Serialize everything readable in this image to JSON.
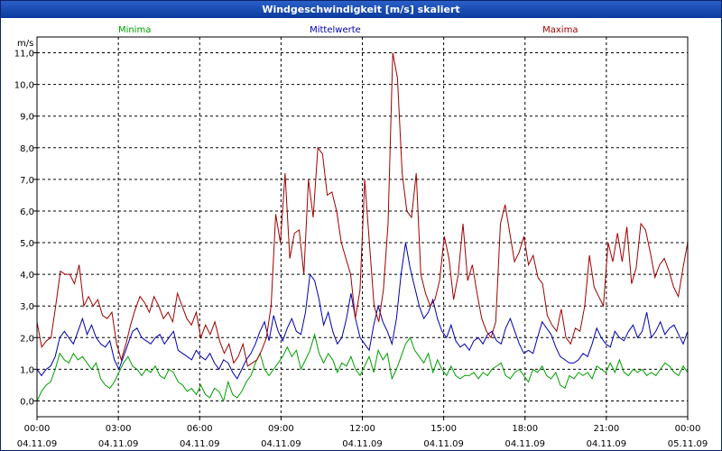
{
  "window": {
    "title": "Windgeschwindigkeit [m/s] skaliert"
  },
  "chart_data": {
    "type": "line",
    "title": "Windgeschwindigkeit [m/s] skaliert",
    "ylabel": "m/s",
    "ylim": [
      -0.5,
      11.5
    ],
    "xlim": [
      0,
      24
    ],
    "y_ticks": [
      "0,0",
      "1,0",
      "2,0",
      "3,0",
      "4,0",
      "5,0",
      "6,0",
      "7,0",
      "8,0",
      "9,0",
      "10,0",
      "11,0"
    ],
    "x_ticks": [
      {
        "time": "00:00",
        "date": "04.11.09"
      },
      {
        "time": "03:00",
        "date": "04.11.09"
      },
      {
        "time": "06:00",
        "date": "04.11.09"
      },
      {
        "time": "09:00",
        "date": "04.11.09"
      },
      {
        "time": "12:00",
        "date": "04.11.09"
      },
      {
        "time": "15:00",
        "date": "04.11.09"
      },
      {
        "time": "18:00",
        "date": "04.11.09"
      },
      {
        "time": "21:00",
        "date": "04.11.09"
      },
      {
        "time": "00:00",
        "date": "05.11.09"
      }
    ],
    "grid": true,
    "legend_position": "top",
    "series": [
      {
        "name": "Minima",
        "color": "#00a000",
        "values": [
          0.0,
          0.3,
          0.5,
          0.6,
          1.0,
          1.5,
          1.3,
          1.2,
          1.5,
          1.3,
          1.4,
          1.2,
          1.0,
          1.2,
          0.7,
          0.5,
          0.4,
          0.6,
          0.9,
          1.2,
          1.4,
          1.1,
          1.0,
          0.8,
          1.0,
          0.9,
          1.1,
          0.8,
          0.7,
          1.0,
          0.9,
          0.6,
          0.5,
          0.3,
          0.4,
          0.2,
          0.5,
          0.2,
          0.1,
          0.4,
          0.3,
          0.0,
          0.6,
          0.2,
          0.1,
          0.3,
          0.6,
          0.8,
          1.2,
          1.5,
          1.0,
          0.8,
          1.0,
          1.2,
          1.4,
          1.7,
          1.4,
          1.6,
          1.0,
          1.3,
          1.6,
          2.1,
          1.5,
          1.2,
          1.5,
          1.3,
          0.9,
          1.2,
          1.1,
          1.4,
          1.0,
          0.8,
          1.1,
          1.4,
          0.9,
          1.6,
          1.3,
          1.5,
          0.7,
          1.0,
          1.4,
          1.8,
          2.0,
          1.6,
          1.4,
          1.2,
          1.5,
          0.9,
          1.3,
          1.0,
          0.8,
          1.1,
          0.8,
          0.7,
          0.8,
          0.8,
          0.9,
          0.7,
          0.9,
          0.8,
          1.0,
          1.1,
          1.2,
          0.8,
          0.7,
          0.9,
          1.0,
          0.8,
          0.6,
          1.0,
          0.9,
          1.1,
          0.8,
          0.7,
          0.9,
          0.5,
          0.4,
          0.8,
          0.7,
          0.9,
          0.8,
          0.9,
          0.7,
          1.1,
          1.0,
          0.9,
          1.2,
          0.9,
          1.3,
          0.9,
          0.8,
          1.0,
          0.9,
          1.0,
          0.8,
          0.9,
          0.8,
          1.0,
          1.2,
          1.1,
          0.9,
          0.8,
          1.1,
          0.9
        ]
      },
      {
        "name": "Mittelwerte",
        "color": "#0000b0",
        "values": [
          1.0,
          0.8,
          1.0,
          1.1,
          1.4,
          2.0,
          2.2,
          2.0,
          1.8,
          2.2,
          2.6,
          2.1,
          2.4,
          2.0,
          1.8,
          1.7,
          1.9,
          1.3,
          1.0,
          1.4,
          1.8,
          2.2,
          2.3,
          2.0,
          1.9,
          1.8,
          2.0,
          2.1,
          1.8,
          2.0,
          2.2,
          1.6,
          1.5,
          1.4,
          1.3,
          1.6,
          1.4,
          1.3,
          1.5,
          1.2,
          1.0,
          1.3,
          1.2,
          0.9,
          0.7,
          1.0,
          1.3,
          1.5,
          1.8,
          2.2,
          2.5,
          1.9,
          2.7,
          2.2,
          1.9,
          2.3,
          2.6,
          2.2,
          2.1,
          2.8,
          4.0,
          3.8,
          3.2,
          2.4,
          2.8,
          2.2,
          1.8,
          2.0,
          2.6,
          3.4,
          2.6,
          2.0,
          1.8,
          1.6,
          2.4,
          3.0,
          2.5,
          2.2,
          1.8,
          2.6,
          4.0,
          5.0,
          4.2,
          3.6,
          3.0,
          2.6,
          2.8,
          3.2,
          2.6,
          2.2,
          2.0,
          2.4,
          1.9,
          1.7,
          1.8,
          1.6,
          1.9,
          2.0,
          1.8,
          2.1,
          2.2,
          1.9,
          1.8,
          2.3,
          2.6,
          2.2,
          1.8,
          1.5,
          1.6,
          1.5,
          2.0,
          2.5,
          2.3,
          2.1,
          1.7,
          1.4,
          1.3,
          1.2,
          1.2,
          1.3,
          1.5,
          1.4,
          1.8,
          2.3,
          2.0,
          1.8,
          1.7,
          2.2,
          2.0,
          1.9,
          2.2,
          2.4,
          2.0,
          2.2,
          2.8,
          2.0,
          2.2,
          2.5,
          2.1,
          2.3,
          2.4,
          2.1,
          1.8,
          2.2
        ]
      },
      {
        "name": "Maxima",
        "color": "#a00000",
        "values": [
          2.5,
          1.7,
          1.9,
          2.0,
          3.0,
          4.1,
          4.0,
          4.0,
          3.7,
          4.3,
          3.0,
          3.3,
          3.0,
          3.2,
          2.7,
          2.6,
          2.8,
          1.8,
          1.3,
          1.8,
          2.4,
          2.9,
          3.3,
          3.1,
          2.8,
          3.3,
          3.0,
          2.6,
          2.8,
          2.5,
          3.4,
          3.0,
          2.6,
          2.4,
          2.8,
          2.0,
          2.4,
          2.1,
          2.5,
          1.9,
          1.5,
          1.8,
          1.2,
          1.4,
          1.8,
          1.1,
          1.2,
          1.3,
          1.6,
          2.0,
          3.0,
          5.9,
          5.0,
          7.2,
          4.5,
          5.3,
          5.4,
          4.0,
          7.0,
          5.8,
          8.0,
          7.8,
          6.5,
          6.6,
          6.0,
          5.0,
          4.5,
          4.0,
          2.6,
          3.5,
          7.0,
          5.0,
          3.0,
          2.5,
          3.5,
          5.6,
          11.0,
          10.2,
          7.2,
          6.0,
          5.8,
          7.2,
          4.0,
          3.4,
          3.0,
          3.2,
          3.8,
          5.2,
          4.5,
          3.2,
          4.0,
          5.6,
          3.8,
          4.3,
          3.4,
          2.6,
          2.2,
          2.0,
          2.5,
          5.6,
          6.2,
          5.3,
          4.4,
          4.7,
          5.2,
          4.3,
          4.6,
          3.9,
          3.7,
          2.7,
          2.4,
          2.2,
          2.9,
          2.0,
          1.8,
          2.3,
          2.2,
          3.0,
          4.6,
          3.6,
          3.3,
          3.0,
          5.0,
          4.4,
          5.3,
          4.4,
          5.5,
          3.7,
          4.2,
          5.6,
          5.4,
          4.7,
          3.9,
          4.3,
          4.5,
          4.1,
          3.6,
          3.3,
          4.2,
          5.0
        ]
      }
    ]
  }
}
